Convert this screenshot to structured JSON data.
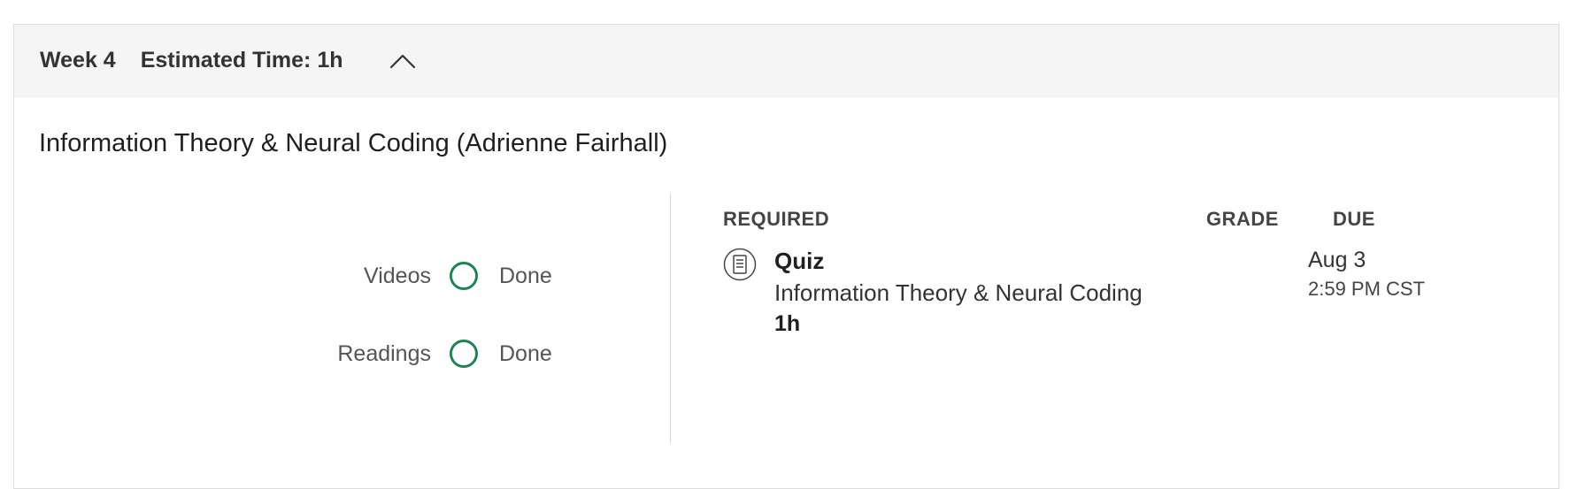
{
  "week": {
    "label": "Week 4",
    "estimated_time": "Estimated Time: 1h",
    "toggle_icon": "chevron-up-icon"
  },
  "module": {
    "title": "Information Theory & Neural Coding (Adrienne Fairhall)"
  },
  "progress": [
    {
      "label": "Videos",
      "status": "Done",
      "icon": "progress-ring-icon",
      "color": "#1f8354"
    },
    {
      "label": "Readings",
      "status": "Done",
      "icon": "progress-ring-icon",
      "color": "#1f8354"
    }
  ],
  "table": {
    "headers": {
      "required": "REQUIRED",
      "grade": "GRADE",
      "due": "DUE"
    },
    "items": [
      {
        "icon": "quiz-icon",
        "type": "Quiz",
        "name": "Information Theory & Neural Coding",
        "duration": "1h",
        "grade": "",
        "due_date": "Aug 3",
        "due_time": "2:59 PM CST"
      }
    ]
  }
}
